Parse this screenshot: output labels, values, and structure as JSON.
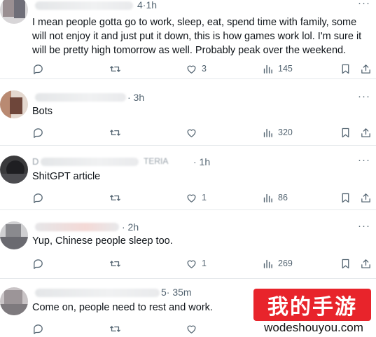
{
  "posts": [
    {
      "time": "·1h",
      "time_prefix": "4",
      "text": "I mean people gotta go to work, sleep, eat, spend time with family, some will not enjoy it and just put it down, this is how games work lol. I'm sure it will be pretty high tomorrow as well. Probably peak over the weekend.",
      "likes": "3",
      "views": "145"
    },
    {
      "time": "· 3h",
      "text": "Bots",
      "likes": "",
      "views": "320"
    },
    {
      "time": "· 1h",
      "name_fragment": "D",
      "handle_fragment": "TERIA",
      "text": "ShitGPT article",
      "likes": "1",
      "views": "86"
    },
    {
      "time": "· 2h",
      "text": "Yup, Chinese people sleep too.",
      "likes": "1",
      "views": "269"
    },
    {
      "time": "· 35m",
      "time_prefix": "5",
      "text": "Come on, people need to rest and work.",
      "likes": "",
      "views": ""
    }
  ],
  "more_label": "···",
  "watermark": {
    "title": "我的手游",
    "url": "wodeshouyou.com"
  },
  "icons": {
    "reply": "reply-icon",
    "repost": "repost-icon",
    "like": "heart-icon",
    "views": "analytics-icon",
    "bookmark": "bookmark-icon",
    "share": "share-icon"
  },
  "colors": {
    "text": "#0f1419",
    "muted": "#536471",
    "divider": "#e6e9ec",
    "watermark_red": "#e8242b"
  }
}
